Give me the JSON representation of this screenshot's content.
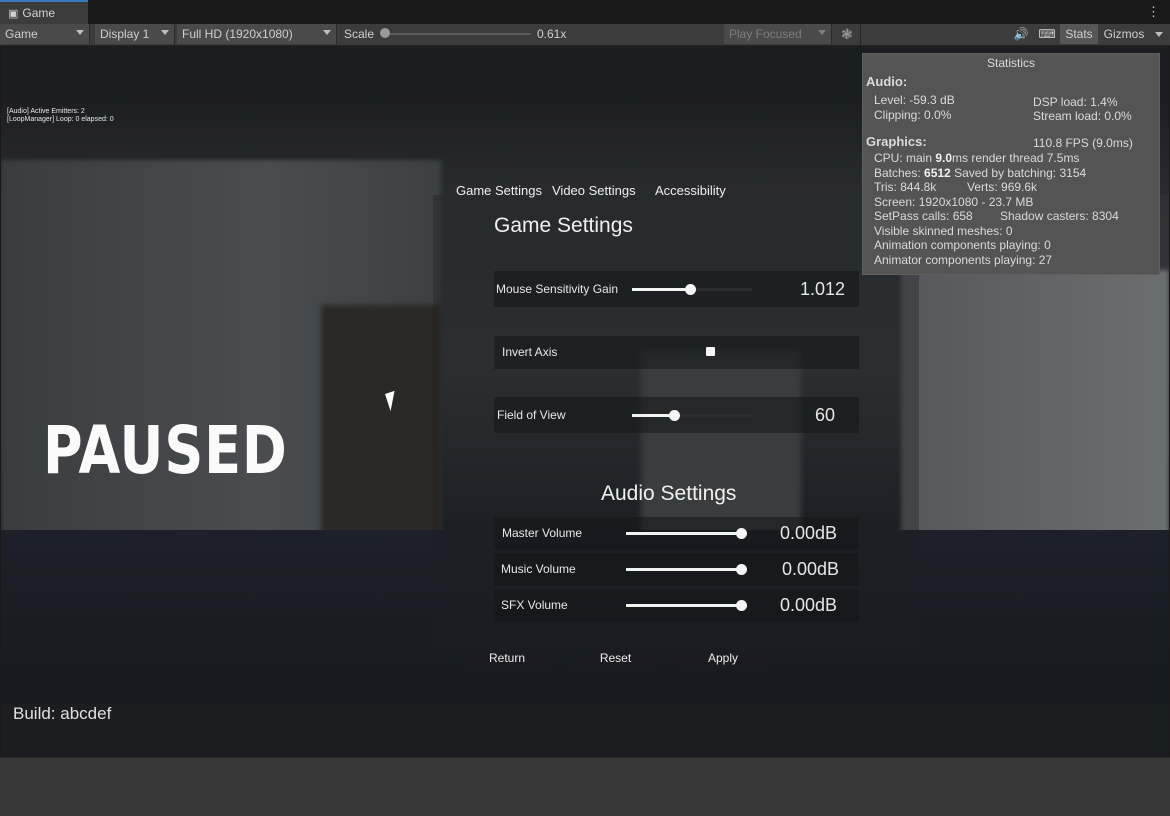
{
  "window": {
    "tab_label": "Game"
  },
  "toolbar": {
    "view_mode": "Game",
    "display": "Display 1",
    "resolution": "Full HD (1920x1080)",
    "scale_label": "Scale",
    "scale_value": "0.61x",
    "scale_fraction": 0.0,
    "play_mode": "Play Focused",
    "stats_label": "Stats",
    "gizmos_label": "Gizmos"
  },
  "debug": {
    "line1": "[Audio] Active Emitters: 2",
    "line2": "[LoopManager] Loop: 0 elapsed: 0"
  },
  "pause_title": "PAUSED",
  "menu_tabs": [
    "Game Settings",
    "Video Settings",
    "Accessibility"
  ],
  "game_settings": {
    "title": "Game Settings",
    "mouse_sensitivity": {
      "label": "Mouse Sensitivity Gain",
      "value": "1.012",
      "fraction": 0.48
    },
    "invert_axis": {
      "label": "Invert Axis",
      "checked": true
    },
    "field_of_view": {
      "label": "Field of View",
      "value": "60",
      "fraction": 0.35
    }
  },
  "audio_settings": {
    "title": "Audio Settings",
    "master": {
      "label": "Master Volume",
      "value": "0.00dB",
      "fraction": 1.0
    },
    "music": {
      "label": "Music Volume",
      "value": "0.00dB",
      "fraction": 1.0
    },
    "sfx": {
      "label": "SFX Volume",
      "value": "0.00dB",
      "fraction": 1.0
    }
  },
  "buttons": {
    "return": "Return",
    "reset": "Reset",
    "apply": "Apply"
  },
  "build": "Build: abcdef",
  "stats": {
    "title": "Statistics",
    "audio_header": "Audio:",
    "level": "Level: -59.3 dB",
    "dsp_load": "DSP load: 1.4%",
    "clipping": "Clipping: 0.0%",
    "stream_load": "Stream load: 0.0%",
    "graphics_header": "Graphics:",
    "fps": "110.8 FPS (9.0ms)",
    "cpu_prefix": "CPU: main ",
    "cpu_main": "9.0",
    "cpu_suffix": "ms  render thread 7.5ms",
    "batches_prefix": "Batches: ",
    "batches_value": "6512",
    "batches_suffix": "   Saved by batching: 3154",
    "tris": "Tris: 844.8k",
    "verts": "Verts: 969.6k",
    "screen": "Screen: 1920x1080 - 23.7 MB",
    "setpass": "SetPass calls: 658",
    "shadow_casters": "Shadow casters: 8304",
    "skinned": "Visible skinned meshes: 0",
    "animation": "Animation components playing: 0",
    "animator": "Animator components playing: 27"
  }
}
